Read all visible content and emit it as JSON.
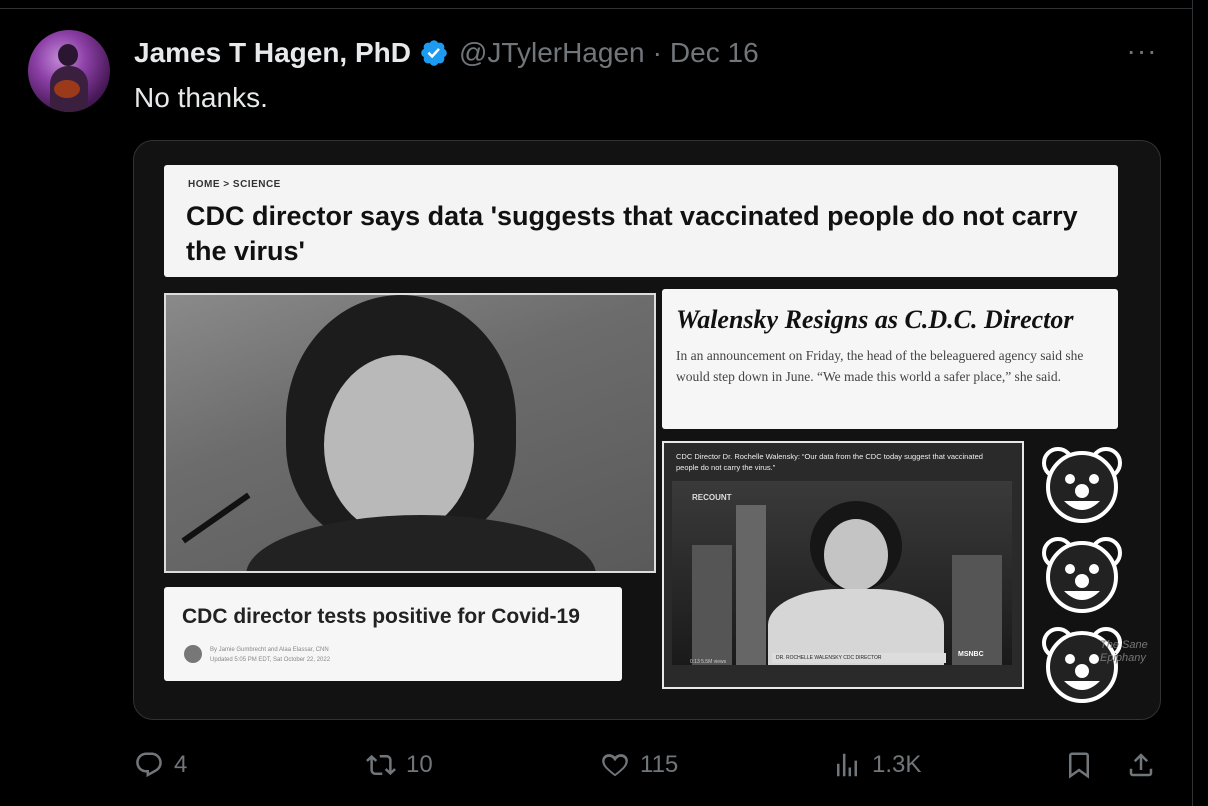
{
  "tweet": {
    "author_name": "James T Hagen, PhD",
    "handle": "@JTylerHagen",
    "separator": "·",
    "date": "Dec 16",
    "more_label": "···",
    "text": "No thanks."
  },
  "media": {
    "breadcrumb": "HOME  >  SCIENCE",
    "headline": "CDC director says data 'suggests that vaccinated people do not carry the virus'",
    "walensky_title": "Walensky Resigns as C.D.C. Director",
    "walensky_body": "In an announcement on Friday, the head of the beleaguered agency said she would step down in June. “We made this world a safer place,” she said.",
    "positive_title": "CDC director tests positive for Covid-19",
    "positive_byline": "By Jamie Gumbrecht and Alaa Elassar, CNN",
    "positive_updated": "Updated 5:05 PM EDT, Sat October 22, 2022",
    "tv_caption": "CDC Director Dr. Rochelle Walensky: “Our data from the CDC today suggest that vaccinated people do not carry the virus.”",
    "tv_show_label": "RECOUNT",
    "tv_chyron": "DR. ROCHELLE WALENSKY  CDC DIRECTOR",
    "tv_network": "MSNBC",
    "tv_time": "0:13  5.5M views",
    "watermark": "The Sane Epiphany"
  },
  "actions": {
    "replies": "4",
    "reposts": "10",
    "likes": "115",
    "views": "1.3K"
  },
  "colors": {
    "background": "#000000",
    "text_primary": "#e7e9ea",
    "text_secondary": "#71767b",
    "verified_blue": "#1d9bf0"
  },
  "icons": [
    "verified-badge-icon",
    "more-options-icon",
    "reply-icon",
    "repost-icon",
    "like-icon",
    "views-icon",
    "bookmark-icon",
    "share-icon",
    "clown-emoji-icon"
  ]
}
